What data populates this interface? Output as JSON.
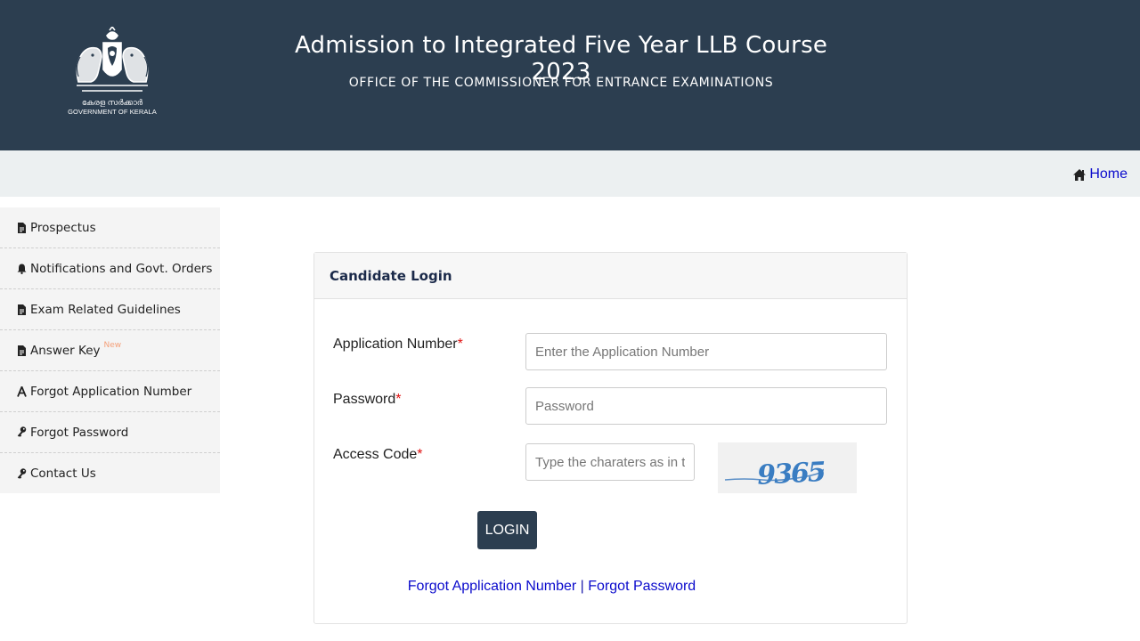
{
  "header": {
    "emblem_malayalam": "കേരള സർക്കാർ",
    "emblem_english": "GOVERNMENT OF KERALA",
    "title": "Admission to Integrated Five Year LLB Course 2023",
    "subtitle": "OFFICE OF THE COMMISSIONER FOR ENTRANCE EXAMINATIONS"
  },
  "nav": {
    "home_label": "Home",
    "home_icon": "home-icon"
  },
  "sidebar": {
    "items": [
      {
        "label": "Prospectus",
        "icon": "pdf-file-icon"
      },
      {
        "label": "Notifications and Govt. Orders",
        "icon": "bell-icon"
      },
      {
        "label": "Exam Related Guidelines",
        "icon": "pdf-file-icon"
      },
      {
        "label": "Answer Key",
        "icon": "pdf-file-icon",
        "badge": "New"
      },
      {
        "label": "Forgot Application Number",
        "icon": "font-icon"
      },
      {
        "label": "Forgot Password",
        "icon": "key-icon"
      },
      {
        "label": "Contact Us",
        "icon": "key-icon"
      }
    ]
  },
  "login": {
    "title": "Candidate Login",
    "application_label": "Application Number",
    "application_placeholder": "Enter the Application Number",
    "password_label": "Password",
    "password_placeholder": "Password",
    "access_label": "Access Code",
    "access_placeholder": "Type the charaters as in the image",
    "required_mark": "*",
    "captcha_text": "9365",
    "button_label": "LOGIN",
    "forgot_app_link": "Forgot Application Number",
    "separator": " | ",
    "forgot_pw_link": "Forgot Password"
  },
  "colors": {
    "header_bg": "#2c3e50",
    "nav_bg": "#ecf0f1",
    "link": "#0a0acc",
    "required": "#e01010",
    "badge": "#f4a07a"
  }
}
